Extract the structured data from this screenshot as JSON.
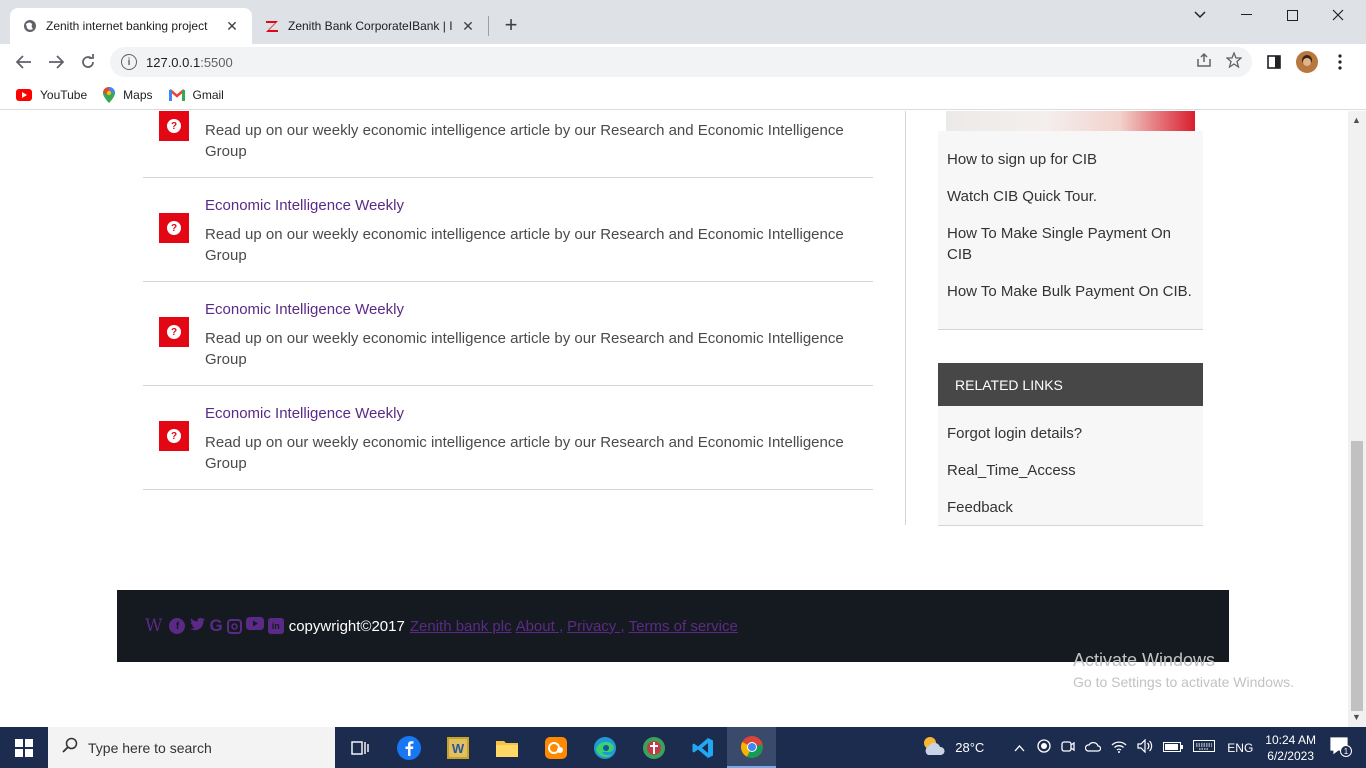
{
  "browser": {
    "tabs": [
      {
        "title": "Zenith internet banking project",
        "active": true
      },
      {
        "title": "Zenith Bank CorporateIBank | Ind",
        "active": false
      }
    ],
    "url": "127.0.0.1",
    "url_port": ":5500",
    "bookmarks": [
      {
        "label": "YouTube",
        "icon": "youtube-icon"
      },
      {
        "label": "Maps",
        "icon": "maps-icon"
      },
      {
        "label": "Gmail",
        "icon": "gmail-icon"
      }
    ]
  },
  "articles": [
    {
      "title": "",
      "desc": "Read up on our weekly economic intelligence article by our Research and Economic Intelligence Group"
    },
    {
      "title": "Economic Intelligence Weekly",
      "desc": "Read up on our weekly economic intelligence article by our Research and Economic Intelligence Group"
    },
    {
      "title": "Economic Intelligence Weekly",
      "desc": "Read up on our weekly economic intelligence article by our Research and Economic Intelligence Group"
    },
    {
      "title": "Economic Intelligence Weekly",
      "desc": "Read up on our weekly economic intelligence article by our Research and Economic Intelligence Group"
    }
  ],
  "sidebar": {
    "cib_links": [
      "How to sign up for CIB",
      "Watch CIB Quick Tour.",
      "How To Make Single Payment On CIB",
      "How To Make Bulk Payment On CIB."
    ],
    "related_heading": "RELATED LINKS",
    "related_links": [
      "Forgot login details?",
      "Real_Time_Access",
      "Feedback"
    ]
  },
  "footer": {
    "copyright": "copywright©2017",
    "links": [
      "Zenith bank plc",
      "About ,",
      "Privacy ,",
      "Terms of service"
    ]
  },
  "watermark": {
    "line1": "Activate Windows",
    "line2": "Go to Settings to activate Windows."
  },
  "taskbar": {
    "search_placeholder": "Type here to search",
    "weather": "28°C",
    "language": "ENG",
    "time": "10:24 AM",
    "date": "6/2/2023",
    "notification_count": "1"
  },
  "colors": {
    "accent": "#5b2a86",
    "brand_red": "#e30613",
    "footer_bg": "#151a21"
  }
}
